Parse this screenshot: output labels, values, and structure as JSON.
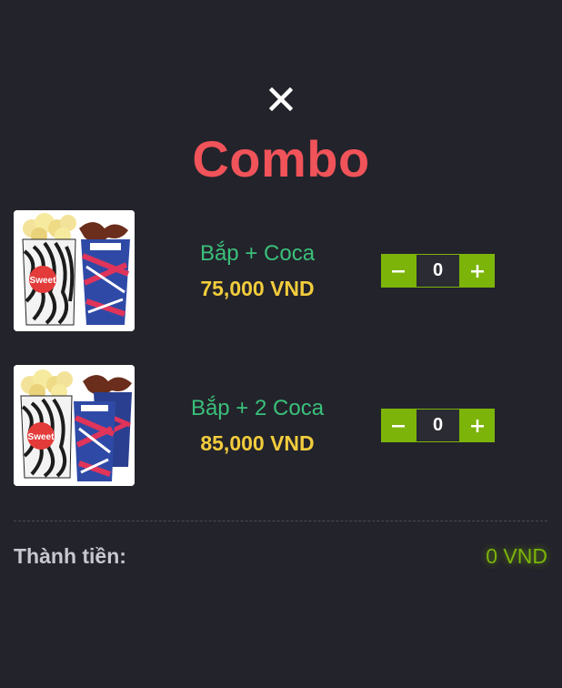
{
  "modal": {
    "title": "Combo",
    "close_icon": "close-icon"
  },
  "items": [
    {
      "name": "Bắp + Coca",
      "price": "75,000 VND",
      "quantity": "0",
      "image": "popcorn-and-one-drink-image"
    },
    {
      "name": "Bắp + 2 Coca",
      "price": "85,000 VND",
      "quantity": "0",
      "image": "popcorn-and-two-drinks-image"
    }
  ],
  "stepper": {
    "minus_icon": "minus-icon",
    "plus_icon": "plus-icon"
  },
  "total": {
    "label": "Thành tiền:",
    "value": "0 VND"
  },
  "colors": {
    "background": "#23232b",
    "title": "#f05359",
    "item_name": "#3ac07a",
    "price": "#f2cc3c",
    "accent": "#7cb40a",
    "total_label": "#c7c8cf"
  }
}
